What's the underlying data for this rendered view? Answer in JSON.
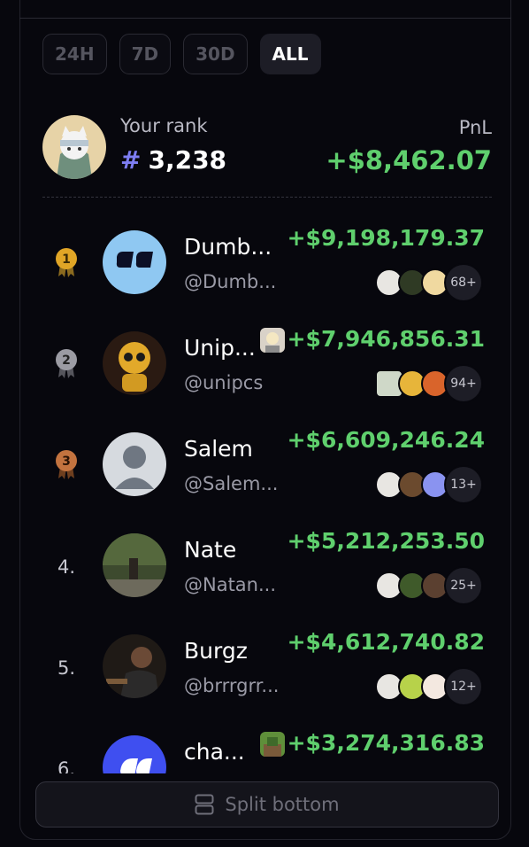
{
  "tabs": [
    "24H",
    "7D",
    "30D",
    "ALL"
  ],
  "active_tab": "ALL",
  "you": {
    "label": "Your rank",
    "hash": "#",
    "rank": "3,238",
    "pnl_label": "PnL",
    "pnl_value": "+$8,462.07"
  },
  "rows": [
    {
      "rank": "1",
      "name": "Dumb...",
      "handle": "@Dumb...",
      "amount": "+$9,198,179.37",
      "count": "68+"
    },
    {
      "rank": "2",
      "name": "Unip...",
      "handle": "@unipcs",
      "amount": "+$7,946,856.31",
      "count": "94+"
    },
    {
      "rank": "3",
      "name": "Salem",
      "handle": "@Salem...",
      "amount": "+$6,609,246.24",
      "count": "13+"
    },
    {
      "rank": "4.",
      "name": "Nate",
      "handle": "@Natan...",
      "amount": "+$5,212,253.50",
      "count": "25+"
    },
    {
      "rank": "5.",
      "name": "Burgz",
      "handle": "@brrrgrr...",
      "amount": "+$4,612,740.82",
      "count": "12+"
    },
    {
      "rank": "6.",
      "name": "cha...",
      "handle": "",
      "amount": "+$3,274,316.83",
      "count": ""
    }
  ],
  "split_button": "Split bottom",
  "colors": {
    "positive": "#5fcf6d",
    "accent": "#7d7df2",
    "gold": "#e0a526",
    "silver": "#9b9ba3",
    "bronze": "#c3733f"
  }
}
